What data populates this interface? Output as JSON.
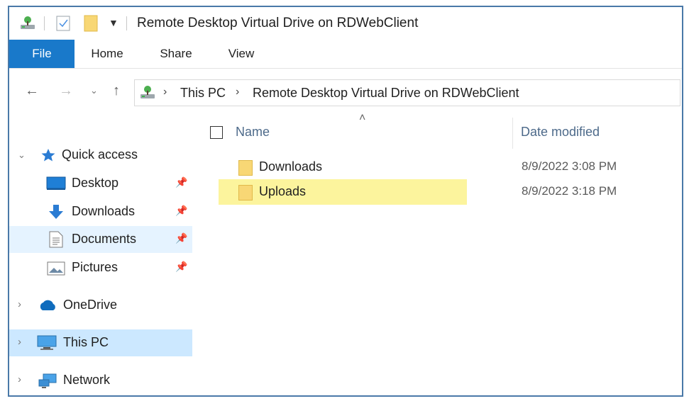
{
  "window": {
    "title": "Remote Desktop Virtual Drive on RDWebClient"
  },
  "quick_access_toolbar": {
    "icons": [
      "drive-icon",
      "properties-icon",
      "new-folder-icon",
      "customize-dropdown-icon"
    ]
  },
  "ribbon": {
    "tabs": [
      {
        "label": "File",
        "active": true
      },
      {
        "label": "Home"
      },
      {
        "label": "Share"
      },
      {
        "label": "View"
      }
    ]
  },
  "address_bar": {
    "breadcrumbs": [
      "This PC",
      "Remote Desktop Virtual Drive on RDWebClient"
    ]
  },
  "nav_pane": {
    "quick_access": {
      "label": "Quick access",
      "items": [
        {
          "label": "Desktop",
          "icon": "desktop-icon",
          "pinned": true
        },
        {
          "label": "Downloads",
          "icon": "download-arrow-icon",
          "pinned": true
        },
        {
          "label": "Documents",
          "icon": "document-icon",
          "pinned": true
        },
        {
          "label": "Pictures",
          "icon": "picture-icon",
          "pinned": true
        }
      ]
    },
    "onedrive": {
      "label": "OneDrive"
    },
    "this_pc": {
      "label": "This PC",
      "selected": true
    },
    "network": {
      "label": "Network"
    }
  },
  "file_list": {
    "columns": {
      "name": "Name",
      "date_modified": "Date modified"
    },
    "rows": [
      {
        "name": "Downloads",
        "date": "8/9/2022 3:08 PM",
        "highlighted": false
      },
      {
        "name": "Uploads",
        "date": "8/9/2022 3:18 PM",
        "highlighted": true
      }
    ]
  },
  "colors": {
    "file_tab": "#1979ca",
    "highlight": "#fbf28c",
    "selected_nav": "#cce8ff",
    "window_border": "#4a79a8",
    "folder": "#f8d775"
  }
}
